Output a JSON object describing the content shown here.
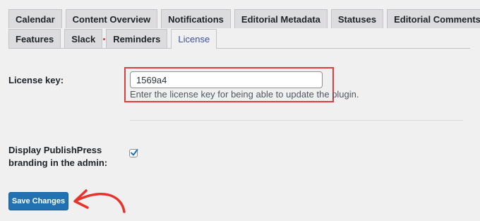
{
  "tabs": {
    "row1": [
      {
        "label": "Calendar"
      },
      {
        "label": "Content Overview"
      },
      {
        "label": "Notifications"
      },
      {
        "label": "Editorial Metadata"
      },
      {
        "label": "Statuses"
      },
      {
        "label": "Editorial Comments"
      }
    ],
    "row2": [
      {
        "label": "Features"
      },
      {
        "label": "Slack"
      },
      {
        "label": "Reminders"
      },
      {
        "label": "License",
        "active": true
      }
    ]
  },
  "license": {
    "label": "License key:",
    "value": "1569a4",
    "hint": "Enter the license key for being able to update the plugin."
  },
  "branding": {
    "label": "Display PublishPress branding in the admin:",
    "checked": true
  },
  "save_label": "Save Changes",
  "colors": {
    "accent": "#2271b1",
    "highlight": "#e03d3d",
    "arrow": "#e8322c"
  }
}
